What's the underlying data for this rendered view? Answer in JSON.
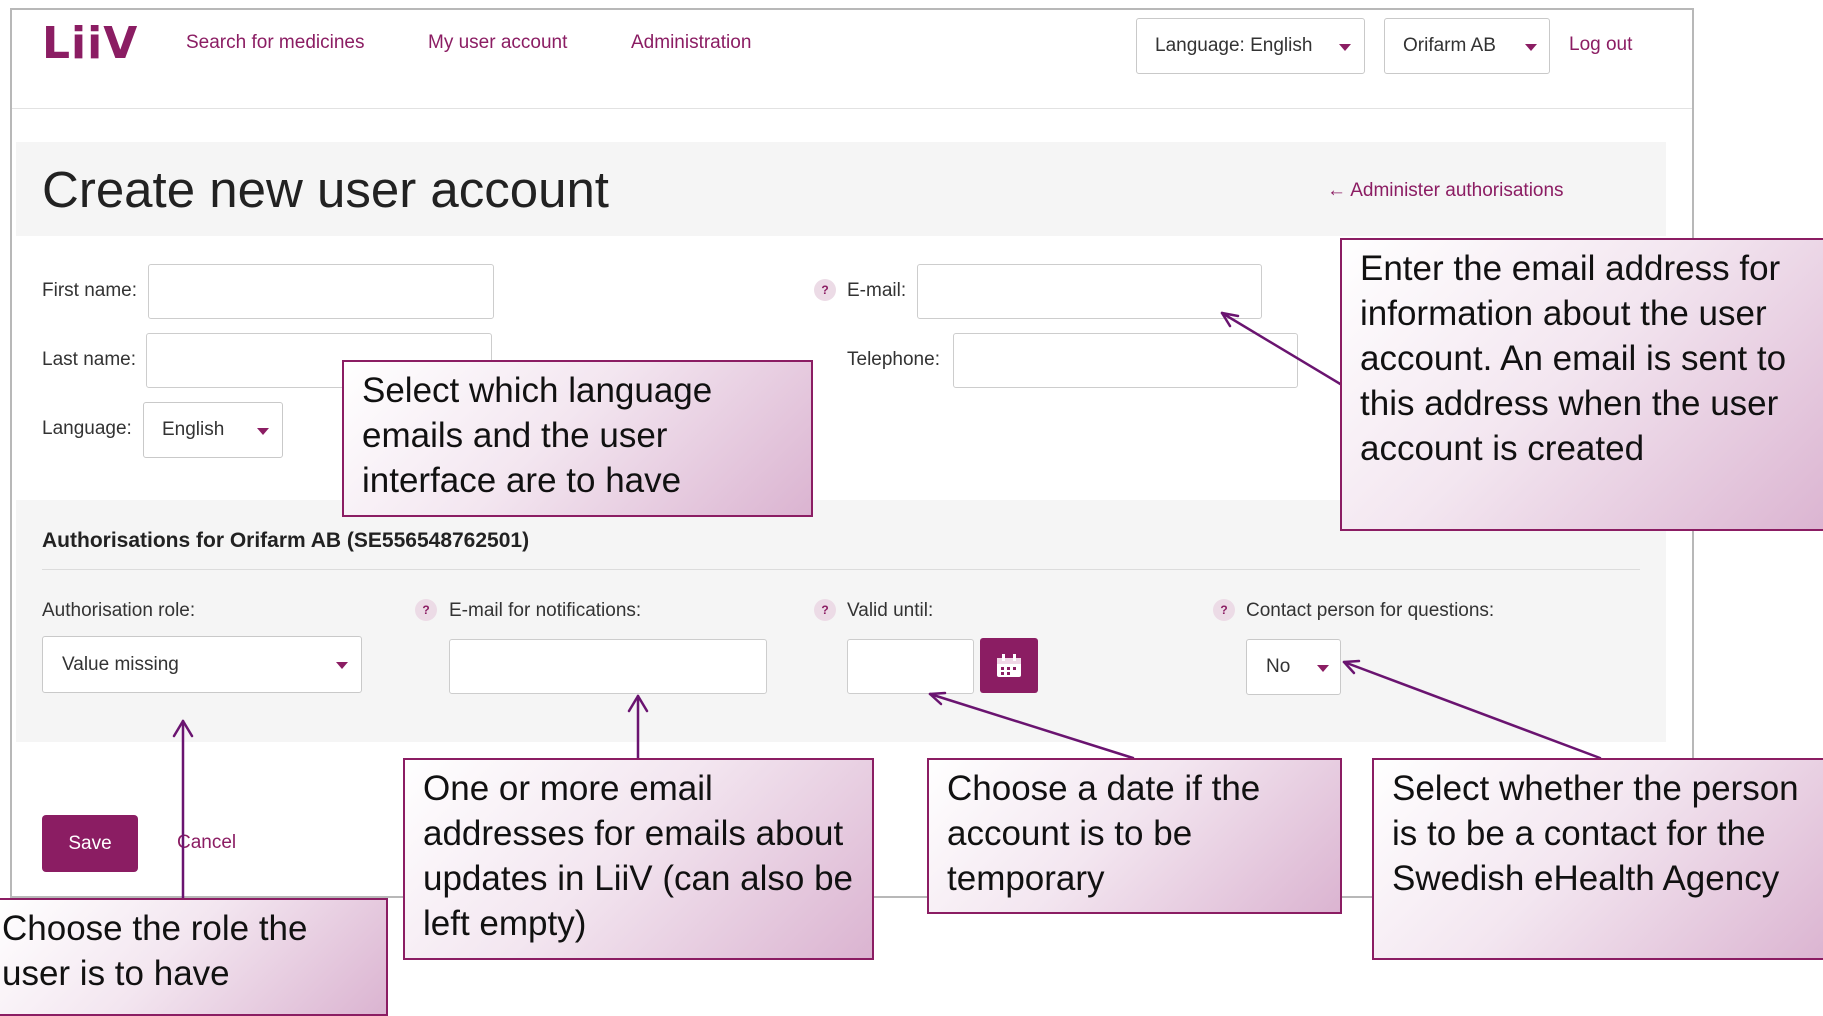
{
  "header": {
    "logo": "LiiV",
    "nav": [
      "Search for medicines",
      "My user account",
      "Administration"
    ],
    "language_dropdown": "Language: English",
    "org_dropdown": "Orifarm AB",
    "logout": "Log out"
  },
  "page": {
    "title": "Create new user account",
    "back_link": "← Administer authorisations"
  },
  "form": {
    "first_name_label": "First name:",
    "last_name_label": "Last name:",
    "language_label": "Language:",
    "language_value": "English",
    "email_label": "E-mail:",
    "telephone_label": "Telephone:"
  },
  "authorisations": {
    "heading": "Authorisations for Orifarm AB (SE556548762501)",
    "role_label": "Authorisation role:",
    "role_value": "Value missing",
    "notify_label": "E-mail for notifications:",
    "valid_label": "Valid until:",
    "contact_label": "Contact person for questions:",
    "contact_value": "No"
  },
  "actions": {
    "save": "Save",
    "cancel": "Cancel"
  },
  "callouts": {
    "email": "Enter the email address for information about the user account. An email is sent to this address when the user account is created",
    "language": "Select which language emails and the user interface are to have",
    "role": "Choose the role the user is to have",
    "notify": "One or more email addresses for emails about updates in LiiV (can also be left empty)",
    "valid": "Choose a date if the account is to be temporary",
    "contact": "Select whether the person is to be a contact for the Swedish eHealth Agency"
  },
  "colors": {
    "brand": "#8b1d63",
    "callout_border": "#8b1d63",
    "panel": "#f5f5f5"
  },
  "icons": [
    "calendar-icon",
    "help-icon",
    "chevron-down-icon"
  ]
}
